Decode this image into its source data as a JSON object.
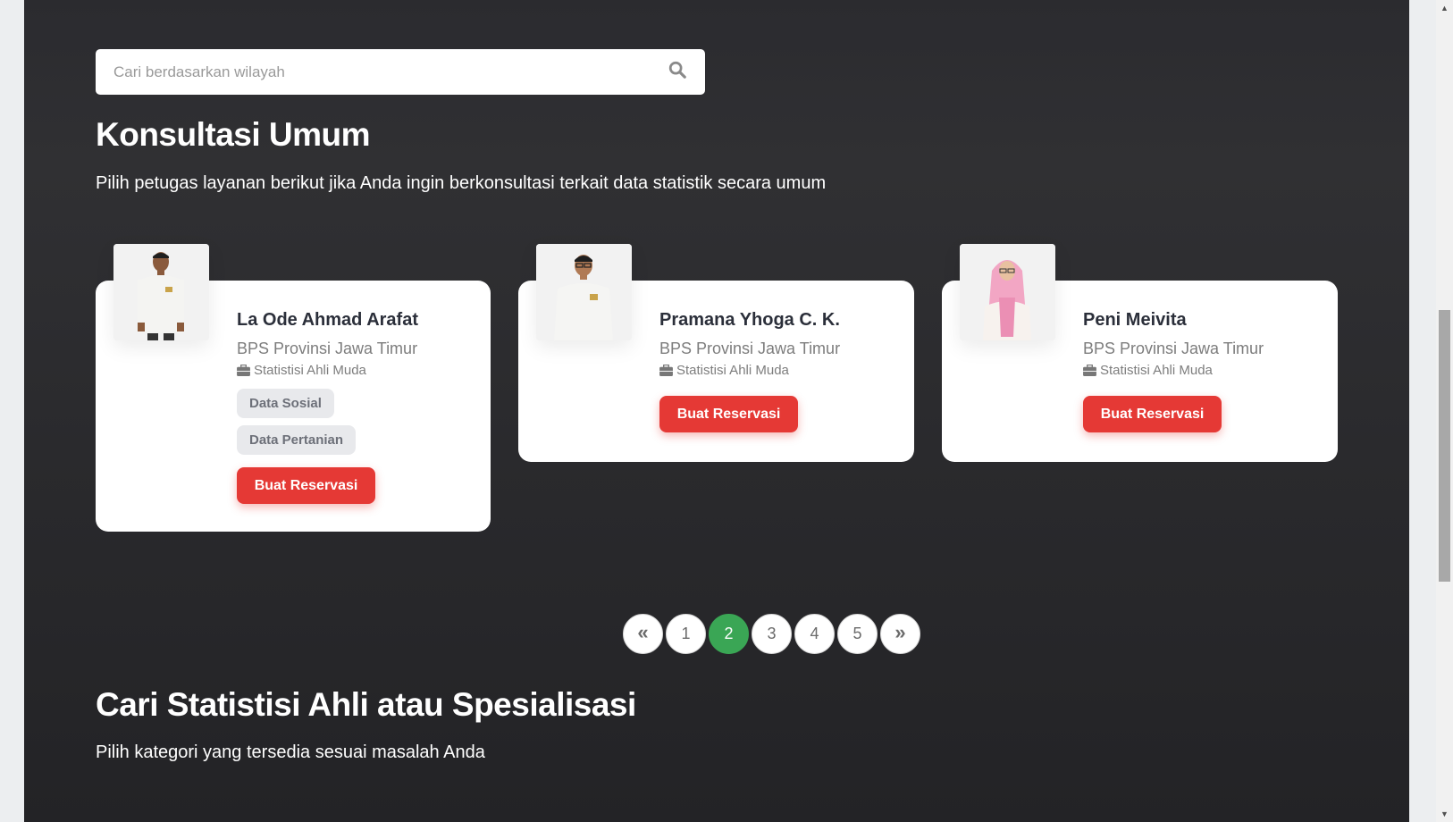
{
  "search": {
    "placeholder": "Cari berdasarkan wilayah",
    "icon": "search-icon"
  },
  "general": {
    "title": "Konsultasi Umum",
    "subtitle": "Pilih petugas layanan berikut jika Anda ingin berkonsultasi terkait data statistik secara umum"
  },
  "consultants": [
    {
      "name": "La Ode Ahmad Arafat",
      "org": "BPS Provinsi Jawa Timur",
      "role": "Statistisi Ahli Muda",
      "tags": [
        "Data Sosial",
        "Data Pertanian"
      ],
      "button": "Buat Reservasi"
    },
    {
      "name": "Pramana Yhoga C. K.",
      "org": "BPS Provinsi Jawa Timur",
      "role": "Statistisi Ahli Muda",
      "tags": [],
      "button": "Buat Reservasi"
    },
    {
      "name": "Peni Meivita",
      "org": "BPS Provinsi Jawa Timur",
      "role": "Statistisi Ahli Muda",
      "tags": [],
      "button": "Buat Reservasi"
    }
  ],
  "pagination": {
    "first": "«",
    "pages": [
      "1",
      "2",
      "3",
      "4",
      "5"
    ],
    "active": "2",
    "last": "»"
  },
  "specialist": {
    "title": "Cari Statistisi Ahli atau Spesialisasi",
    "subtitle": "Pilih kategori yang tersedia sesuai masalah Anda"
  },
  "colors": {
    "accent_red": "#e53935",
    "active_page_green": "#3aa655",
    "section_bg": "#2b2b2f"
  }
}
